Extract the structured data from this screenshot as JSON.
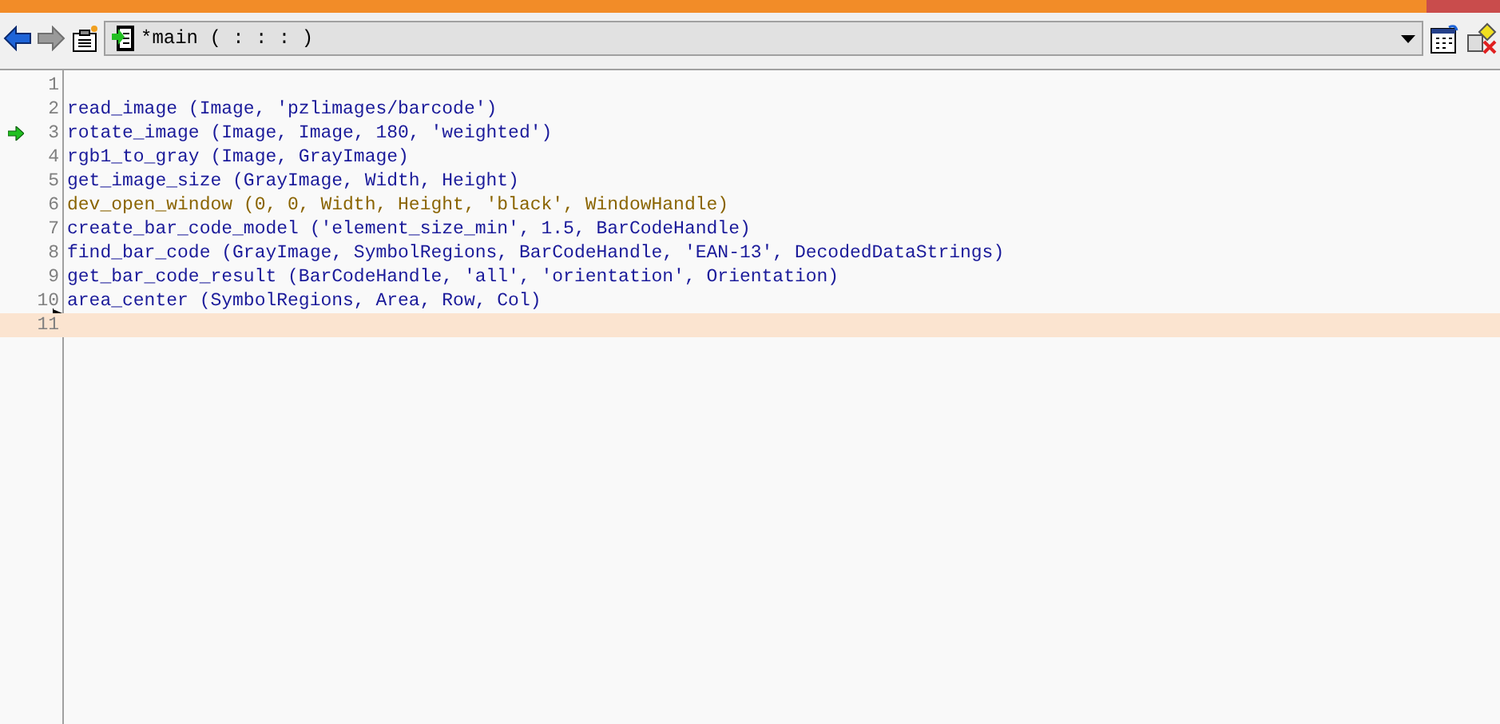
{
  "toolbar": {
    "procedure": "*main ( : : : )"
  },
  "editor": {
    "lines": [
      {
        "number": "1",
        "pc": false,
        "insert": false,
        "current": false
      },
      {
        "number": "2",
        "code": "read_image (Image, 'pzlimages/barcode')",
        "kind": "operator",
        "pc": false,
        "insert": false,
        "current": false
      },
      {
        "number": "3",
        "code": "rotate_image (Image, Image, 180, 'weighted')",
        "kind": "operator",
        "pc": true,
        "insert": false,
        "current": false
      },
      {
        "number": "4",
        "code": "rgb1_to_gray (Image, GrayImage)",
        "kind": "operator",
        "pc": false,
        "insert": false,
        "current": false
      },
      {
        "number": "5",
        "code": "get_image_size (GrayImage, Width, Height)",
        "kind": "operator",
        "pc": false,
        "insert": false,
        "current": false
      },
      {
        "number": "6",
        "code": "dev_open_window (0, 0, Width, Height, 'black', WindowHandle)",
        "kind": "dev",
        "pc": false,
        "insert": false,
        "current": false
      },
      {
        "number": "7",
        "code": "create_bar_code_model ('element_size_min', 1.5, BarCodeHandle)",
        "kind": "operator",
        "pc": false,
        "insert": false,
        "current": false
      },
      {
        "number": "8",
        "code": "find_bar_code (GrayImage, SymbolRegions, BarCodeHandle, 'EAN-13', DecodedDataStrings)",
        "kind": "operator",
        "pc": false,
        "insert": false,
        "current": false
      },
      {
        "number": "9",
        "code": "get_bar_code_result (BarCodeHandle, 'all', 'orientation', Orientation)",
        "kind": "operator",
        "pc": false,
        "insert": false,
        "current": false
      },
      {
        "number": "10",
        "code": "area_center (SymbolRegions, Area, Row, Col)",
        "kind": "operator",
        "pc": false,
        "insert": true,
        "current": false
      },
      {
        "number": "11",
        "pc": false,
        "insert": false,
        "current": true
      }
    ]
  }
}
